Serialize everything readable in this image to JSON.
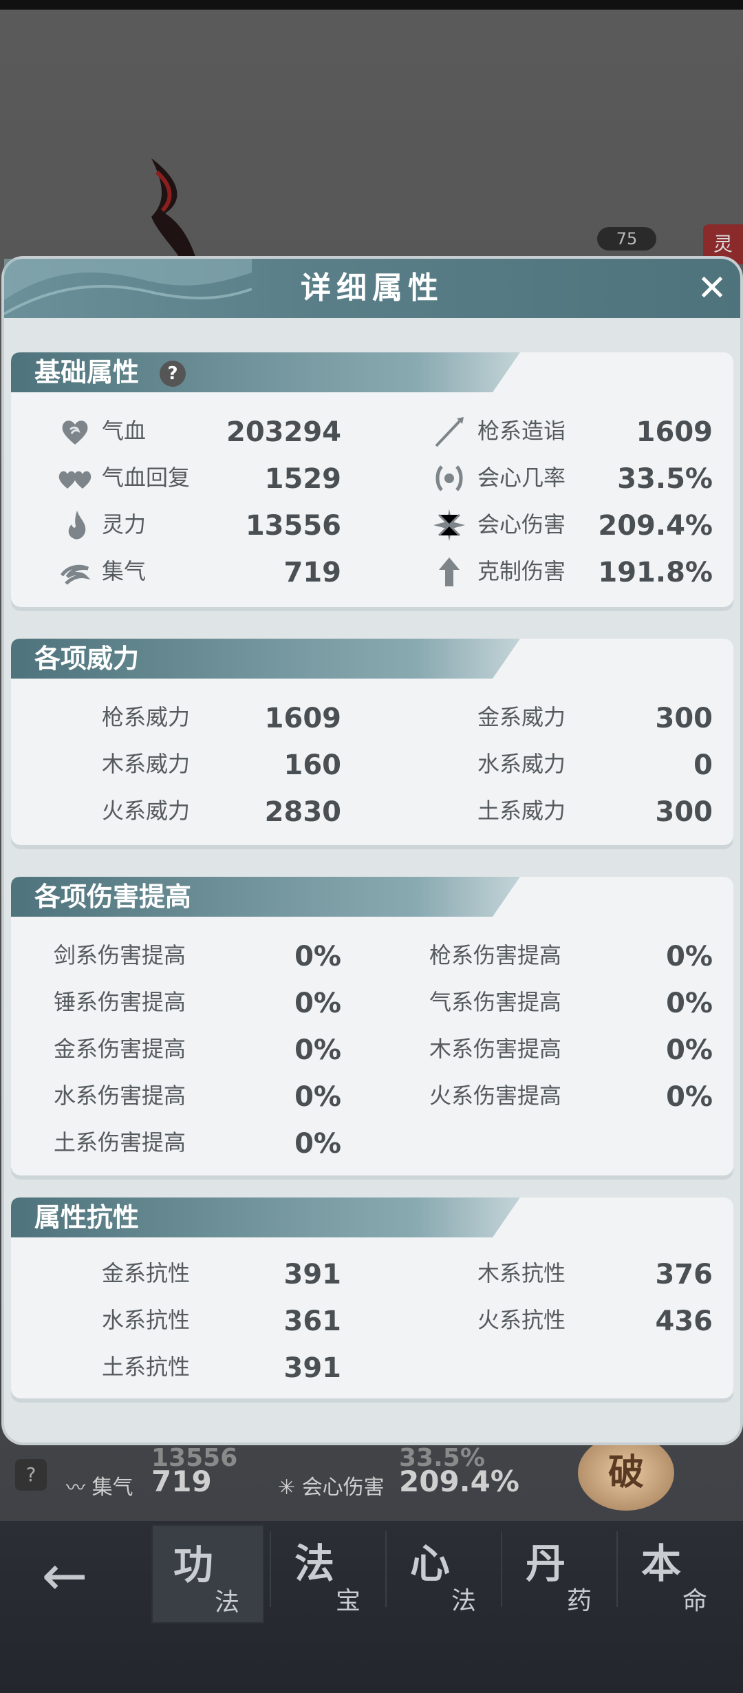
{
  "background": {
    "level_badge": "75",
    "side_tag": "灵",
    "under_row": {
      "attr1_label": "集气",
      "attr1_value": "719",
      "attr2_label": "会心伤害",
      "attr2_value": "209.4%",
      "top_partial_value1": "13556",
      "top_partial_value2": "33.5%"
    },
    "break_button": "破",
    "help_mark": "?"
  },
  "bottom_nav": {
    "tabs": [
      {
        "big": "功",
        "small": "法"
      },
      {
        "big": "法",
        "small": "宝"
      },
      {
        "big": "心",
        "small": "法"
      },
      {
        "big": "丹",
        "small": "药"
      },
      {
        "big": "本",
        "small": "命"
      }
    ]
  },
  "modal": {
    "title": "详细属性",
    "sections": {
      "basic": {
        "title": "基础属性",
        "help": "?",
        "left": [
          {
            "label": "气血",
            "value": "203294",
            "icon": "heart-icon"
          },
          {
            "label": "气血回复",
            "value": "1529",
            "icon": "double-heart-icon"
          },
          {
            "label": "灵力",
            "value": "13556",
            "icon": "flame-icon"
          },
          {
            "label": "集气",
            "value": "719",
            "icon": "swirl-icon"
          }
        ],
        "right": [
          {
            "label": "枪系造诣",
            "value": "1609",
            "icon": "spear-icon"
          },
          {
            "label": "会心几率",
            "value": "33.5%",
            "icon": "crit-rate-icon"
          },
          {
            "label": "会心伤害",
            "value": "209.4%",
            "icon": "starburst-icon"
          },
          {
            "label": "克制伤害",
            "value": "191.8%",
            "icon": "arrow-up-icon"
          }
        ]
      },
      "power": {
        "title": "各项威力",
        "left": [
          {
            "label": "枪系威力",
            "value": "1609"
          },
          {
            "label": "木系威力",
            "value": "160"
          },
          {
            "label": "火系威力",
            "value": "2830"
          }
        ],
        "right": [
          {
            "label": "金系威力",
            "value": "300"
          },
          {
            "label": "水系威力",
            "value": "0"
          },
          {
            "label": "土系威力",
            "value": "300"
          }
        ]
      },
      "damage": {
        "title": "各项伤害提高",
        "left": [
          {
            "label": "剑系伤害提高",
            "value": "0%"
          },
          {
            "label": "锤系伤害提高",
            "value": "0%"
          },
          {
            "label": "金系伤害提高",
            "value": "0%"
          },
          {
            "label": "水系伤害提高",
            "value": "0%"
          },
          {
            "label": "土系伤害提高",
            "value": "0%"
          }
        ],
        "right": [
          {
            "label": "枪系伤害提高",
            "value": "0%"
          },
          {
            "label": "气系伤害提高",
            "value": "0%"
          },
          {
            "label": "木系伤害提高",
            "value": "0%"
          },
          {
            "label": "火系伤害提高",
            "value": "0%"
          }
        ]
      },
      "resist": {
        "title": "属性抗性",
        "left": [
          {
            "label": "金系抗性",
            "value": "391"
          },
          {
            "label": "水系抗性",
            "value": "361"
          },
          {
            "label": "土系抗性",
            "value": "391"
          }
        ],
        "right": [
          {
            "label": "木系抗性",
            "value": "376"
          },
          {
            "label": "火系抗性",
            "value": "436"
          }
        ]
      }
    }
  }
}
